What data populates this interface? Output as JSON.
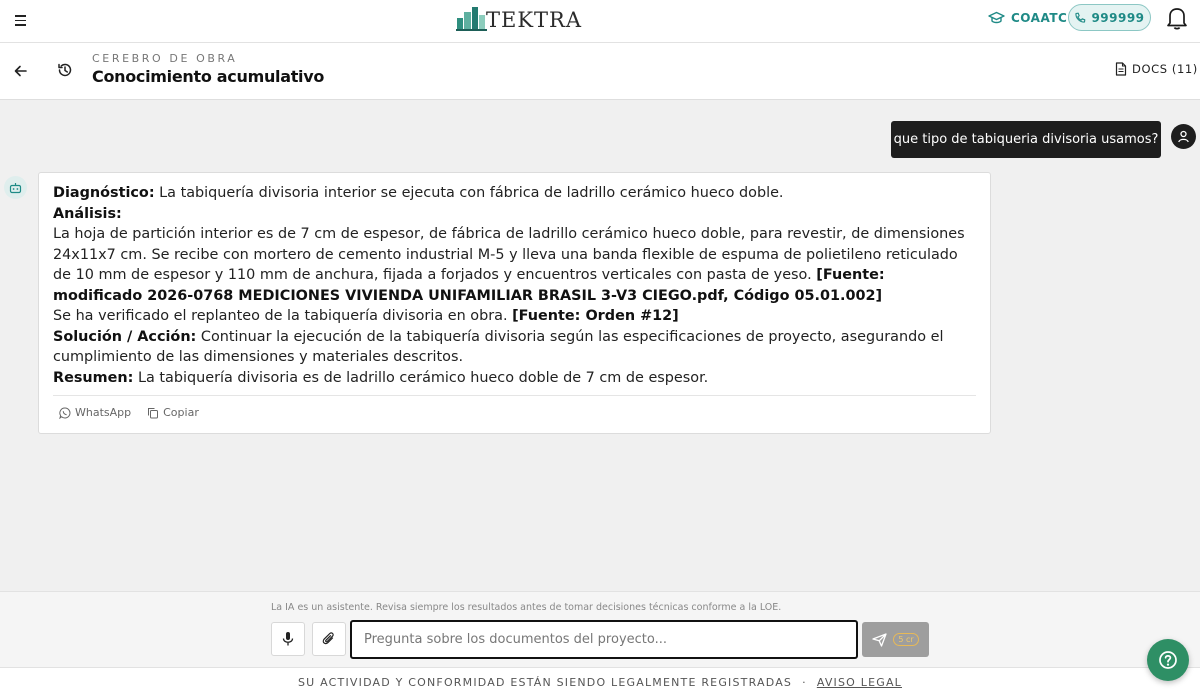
{
  "header": {
    "brand": "TEKTRA",
    "org_label": "COAATC",
    "credits": "999999"
  },
  "subheader": {
    "eyebrow": "CEREBRO DE OBRA",
    "title": "Conocimiento acumulativo",
    "docs_label": "DOCS (11)"
  },
  "conversation": {
    "user_message": "que tipo de tabiqueria divisoria usamos?",
    "answer": {
      "diagnosis_label": "Diagnóstico:",
      "diagnosis_text": " La tabiquería divisoria interior se ejecuta con fábrica de ladrillo cerámico hueco doble.",
      "analysis_label": "Análisis:",
      "analysis_text": "La hoja de partición interior es de 7 cm de espesor, de fábrica de ladrillo cerámico hueco doble, para revestir, de dimensiones 24x11x7 cm. Se recibe con mortero de cemento industrial M-5 y lleva una banda flexible de espuma de polietileno reticulado de 10 mm de espesor y 110 mm de anchura, fijada a forjados y encuentros verticales con pasta de yeso. ",
      "analysis_source": "[Fuente: modificado 2026-0768 MEDICIONES VIVIENDA UNIFAMILIAR BRASIL 3-V3 CIEGO.pdf, Código 05.01.002]",
      "verification_text": "Se ha verificado el replanteo de la tabiquería divisoria en obra. ",
      "verification_source": "[Fuente: Orden #12]",
      "solution_label": "Solución / Acción:",
      "solution_text": " Continuar la ejecución de la tabiquería divisoria según las especificaciones de proyecto, asegurando el cumplimiento de las dimensiones y materiales descritos.",
      "summary_label": "Resumen:",
      "summary_text": " La tabiquería divisoria es de ladrillo cerámico hueco doble de 7 cm de espesor."
    },
    "actions": {
      "whatsapp": "WhatsApp",
      "copy": "Copiar"
    }
  },
  "composer": {
    "disclaimer": "La IA es un asistente. Revisa siempre los resultados antes de tomar decisiones técnicas conforme a la LOE.",
    "placeholder": "Pregunta sobre los documentos del proyecto...",
    "send_cost": "5 cr"
  },
  "footer": {
    "notice": "SU ACTIVIDAD Y CONFORMIDAD ESTÁN SIENDO LEGALMENTE REGISTRADAS",
    "separator": "·",
    "legal_link": "AVISO LEGAL"
  },
  "colors": {
    "accent": "#1f8a86",
    "help_button": "#2e8f65",
    "user_bubble": "#1e1e1e"
  },
  "icons": [
    "menu-icon",
    "tektra-logo-icon",
    "graduation-cap-icon",
    "phone-icon",
    "bell-icon",
    "back-arrow-icon",
    "history-icon",
    "document-icon",
    "user-icon",
    "robot-icon",
    "whatsapp-icon",
    "copy-icon",
    "microphone-icon",
    "paperclip-icon",
    "send-icon",
    "help-icon"
  ]
}
